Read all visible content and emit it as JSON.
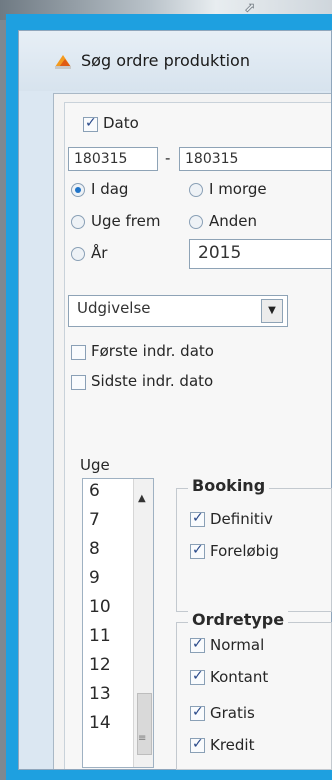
{
  "window": {
    "title": "Søg ordre produktion"
  },
  "dato": {
    "checkbox_label": "Dato",
    "from_value": "180315",
    "separator": "-",
    "to_value": "180315"
  },
  "period_radios": [
    {
      "label": "I dag",
      "selected": true
    },
    {
      "label": "I morge",
      "selected": false
    },
    {
      "label": "Uge frem",
      "selected": false
    },
    {
      "label": "Anden",
      "selected": false
    },
    {
      "label": "År",
      "selected": false
    }
  ],
  "year_select": {
    "value": "2015"
  },
  "date_type_select": {
    "value": "Udgivelse"
  },
  "indr_checks": [
    {
      "label": "Første indr. dato",
      "checked": false
    },
    {
      "label": "Sidste indr. dato",
      "checked": false
    }
  ],
  "uge": {
    "label": "Uge",
    "items": [
      "6",
      "7",
      "8",
      "9",
      "10",
      "11",
      "12",
      "13",
      "14"
    ]
  },
  "booking": {
    "title": "Booking",
    "options": [
      {
        "label": "Definitiv",
        "checked": true
      },
      {
        "label": "Foreløbig",
        "checked": true
      }
    ]
  },
  "ordretype": {
    "title": "Ordretype",
    "options": [
      {
        "label": "Normal",
        "checked": true
      },
      {
        "label": "Kontant",
        "checked": true
      },
      {
        "label": "Gratis",
        "checked": true
      },
      {
        "label": "Kredit",
        "checked": true
      }
    ]
  }
}
